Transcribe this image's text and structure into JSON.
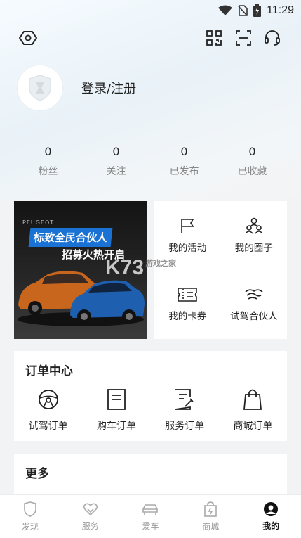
{
  "status_bar": {
    "time": "11:29"
  },
  "profile": {
    "login_text": "登录/注册"
  },
  "stats": [
    {
      "count": "0",
      "label": "粉丝"
    },
    {
      "count": "0",
      "label": "关注"
    },
    {
      "count": "0",
      "label": "已发布"
    },
    {
      "count": "0",
      "label": "已收藏"
    }
  ],
  "banner": {
    "brand": "PEUGEOT",
    "headline": "标致全民合伙人",
    "subline": "招募火热开启"
  },
  "quick_links": [
    {
      "label": "我的活动",
      "icon": "flag-icon"
    },
    {
      "label": "我的圈子",
      "icon": "people-icon"
    },
    {
      "label": "我的卡券",
      "icon": "coupon-icon"
    },
    {
      "label": "试驾合伙人",
      "icon": "handshake-icon"
    }
  ],
  "orders": {
    "title": "订单中心",
    "items": [
      {
        "label": "试驾订单",
        "icon": "steering-wheel-icon"
      },
      {
        "label": "购车订单",
        "icon": "document-icon"
      },
      {
        "label": "服务订单",
        "icon": "service-doc-icon"
      },
      {
        "label": "商城订单",
        "icon": "shopping-bag-icon"
      }
    ]
  },
  "more": {
    "title": "更多"
  },
  "tabs": [
    {
      "label": "发现",
      "icon": "shield-icon",
      "active": false
    },
    {
      "label": "服务",
      "icon": "heart-hands-icon",
      "active": false
    },
    {
      "label": "爱车",
      "icon": "car-icon",
      "active": false
    },
    {
      "label": "商城",
      "icon": "store-bag-icon",
      "active": false
    },
    {
      "label": "我的",
      "icon": "user-icon",
      "active": true
    }
  ],
  "watermark": {
    "text": "K73",
    "sub": "游戏之家"
  },
  "colors": {
    "accent": "#1a73d4",
    "background": "#f2f3f5",
    "active_tab": "#111111",
    "inactive_tab": "#999999"
  }
}
